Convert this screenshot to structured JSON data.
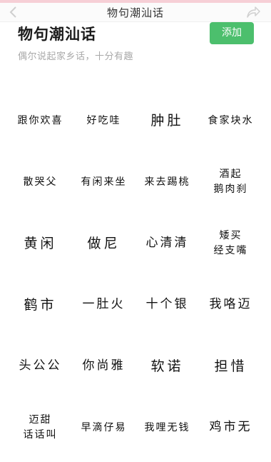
{
  "navbar": {
    "title": "物句潮汕话"
  },
  "header": {
    "title": "物句潮汕话",
    "subtitle": "偶尔说起家乡话，十分有趣",
    "add_label": "添加"
  },
  "phrases": [
    "跟你欢喜",
    "好吃哇",
    "肿肚",
    "食家块水",
    "散哭父",
    "有闲来坐",
    "来去踢桃",
    "酒起\n鹅肉刹",
    "黄闲",
    "做尼",
    "心清清",
    "矮买\n经支嘴",
    "鹤市",
    "一肚火",
    "十个银",
    "我咯迈",
    "头公公",
    "你尚雅",
    "软诺",
    "担惜",
    "迈甜\n话话叫",
    "早滴仔易",
    "我哩无钱",
    "鸡市无"
  ],
  "colors": {
    "accent": "#4cbf6d",
    "top_strip": "#f6cfd6"
  },
  "icons": {
    "back": "chevron-left-icon",
    "share": "share-icon"
  }
}
